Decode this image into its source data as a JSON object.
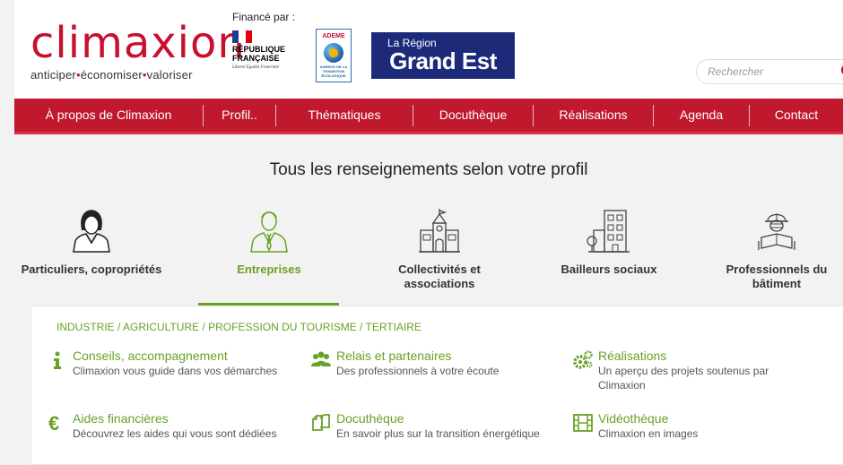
{
  "brand": {
    "logo_text": "climaxion",
    "tagline_1": "anticiper",
    "tagline_2": "économiser",
    "tagline_3": "valoriser",
    "separator": "•"
  },
  "funders": {
    "label": "Financé par :",
    "republique_line1": "RÉPUBLIQUE",
    "republique_line2": "FRANÇAISE",
    "republique_motto": "Liberté Égalité Fraternité",
    "ademe": "ADEME",
    "ademe_sub": "AGENCE DE LA TRANSITION ÉCOLOGIQUE",
    "region_small": "La Région",
    "region_big": "Grand Est"
  },
  "search": {
    "placeholder": "Rechercher"
  },
  "nav": {
    "items": [
      "À propos de Climaxion",
      "Profil..",
      "Thématiques",
      "Docuthèque",
      "Réalisations",
      "Agenda",
      "Contact"
    ]
  },
  "profile_section": {
    "title": "Tous les renseignements selon votre profil",
    "profiles": [
      "Particuliers, copropriétés",
      "Entreprises",
      "Collectivités et associations",
      "Bailleurs sociaux",
      "Professionnels du bâtiment"
    ],
    "active": "Entreprises"
  },
  "panel": {
    "sector": "INDUSTRIE / AGRICULTURE / PROFESSION DU TOURISME / TERTIAIRE",
    "links": [
      {
        "title": "Conseils, accompagnement",
        "desc": "Climaxion vous guide dans vos démarches",
        "icon": "info-icon"
      },
      {
        "title": "Relais et partenaires",
        "desc": "Des professionnels à votre écoute",
        "icon": "people-icon"
      },
      {
        "title": "Réalisations",
        "desc": "Un aperçu des projets soutenus par Climaxion",
        "icon": "gears-icon"
      },
      {
        "title": "Aides financières",
        "desc": "Découvrez les aides qui vous sont dédiées",
        "icon": "euro-icon"
      },
      {
        "title": "Docuthèque",
        "desc": "En savoir plus sur la transition énergétique",
        "icon": "documents-icon"
      },
      {
        "title": "Vidéothèque",
        "desc": "Climaxion en images",
        "icon": "film-icon"
      }
    ]
  },
  "colors": {
    "brand_red": "#c0182d",
    "accent_green": "#68a226",
    "region_blue": "#1d2a7a"
  }
}
